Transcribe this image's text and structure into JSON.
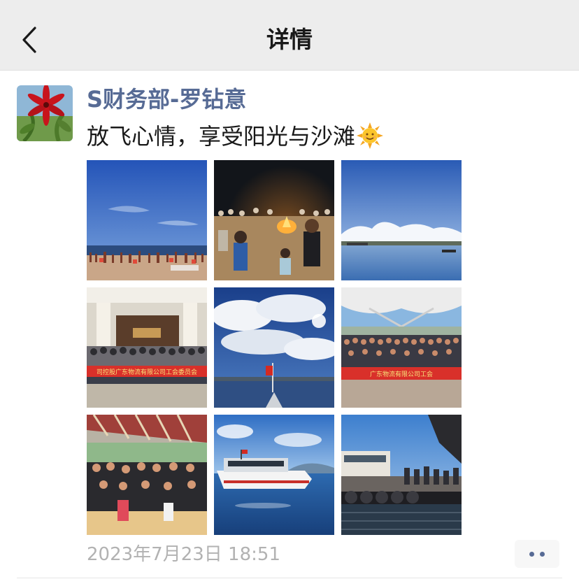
{
  "header": {
    "title": "详情",
    "back_icon": "chevron-left-icon"
  },
  "post": {
    "author": "S财务部-罗钻意",
    "text": "放飞心情，享受阳光与沙滩",
    "emoji": "sun-with-face-icon",
    "timestamp": "2023年7月23日 18:51",
    "photos": [
      {
        "description": "beach-crowd-blue-sky"
      },
      {
        "description": "night-bonfire-on-beach"
      },
      {
        "description": "sea-with-clouds-and-boats"
      },
      {
        "description": "group-photo-with-red-banner-under-building"
      },
      {
        "description": "sky-clouds-from-boat-with-flag"
      },
      {
        "description": "group-photo-under-tent-roof-with-banner"
      },
      {
        "description": "group-seated-on-boat-deck"
      },
      {
        "description": "speedboat-on-water"
      },
      {
        "description": "pier-with-boats-and-people"
      }
    ],
    "banner_texts": [
      "司控股广东物流有限公司工会委员会",
      "广东物流有限公司工会"
    ]
  },
  "more_button": {
    "icon": "more-dots-icon"
  },
  "colors": {
    "topbar_bg": "#ededed",
    "author_link": "#576b95",
    "timestamp": "#b2b2b2",
    "banner_red": "#d9302a"
  }
}
